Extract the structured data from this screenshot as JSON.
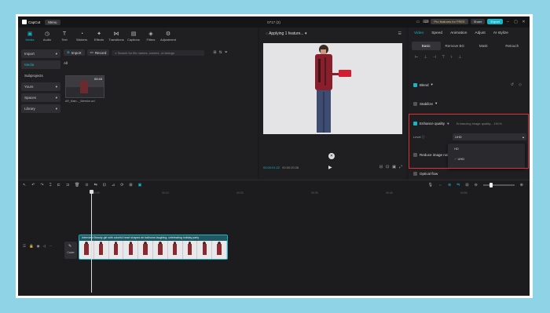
{
  "app": {
    "name": "CapCut",
    "menu_label": "Menu",
    "project_title": "0717 (2)",
    "pro_label": "Pro features for FREE",
    "share_label": "Share",
    "export_label": "Export"
  },
  "tools": [
    {
      "label": "Media",
      "icon": "media-icon"
    },
    {
      "label": "Audio",
      "icon": "audio-icon"
    },
    {
      "label": "Text",
      "icon": "text-icon"
    },
    {
      "label": "Stickers",
      "icon": "stickers-icon"
    },
    {
      "label": "Effects",
      "icon": "effects-icon"
    },
    {
      "label": "Transitions",
      "icon": "transitions-icon"
    },
    {
      "label": "Captions",
      "icon": "captions-icon"
    },
    {
      "label": "Filters",
      "icon": "filters-icon"
    },
    {
      "label": "Adjustment",
      "icon": "adjustment-icon"
    }
  ],
  "sidebar": {
    "import": "Import",
    "media": "Media",
    "subprojects": "Subprojects",
    "yours": "Yours",
    "spaces": "Spaces",
    "library": "Library"
  },
  "media": {
    "import_btn": "Import",
    "record_btn": "Record",
    "search_placeholder": "Search for file names, scenes, or dialogs",
    "all_label": "All",
    "thumb_duration": "00:43",
    "thumb_name": "AR_Main..._Weeshe.avi"
  },
  "player": {
    "status": "Applying 1 feature...",
    "time_current": "00:00:01:22",
    "time_total": "00:00:20:26"
  },
  "props": {
    "tabs": [
      "Video",
      "Speed",
      "Animation",
      "Adjust",
      "AI stylize"
    ],
    "subtabs": [
      "Basic",
      "Remove BG",
      "Mask",
      "Retouch"
    ],
    "blend": "Blend",
    "stabilize": "Stabilize",
    "enhance_quality": "Enhance quality",
    "enhance_status": "Enhancing image quality... 191%",
    "level_label": "Level",
    "level_value": "UHD",
    "reduce_noise": "Reduce image noise",
    "optical_flow": "Optical flow",
    "dropdown_options": [
      "HD",
      "UHD"
    ]
  },
  "timeline": {
    "ruler": [
      "00:00",
      "00:10",
      "00:20",
      "00:30",
      "00:40",
      "00:50"
    ],
    "cover_label": "Cover",
    "clip_title": "Interview Beauty girl with colorful heart shaped air balloons laughing, celebrating holiday party"
  },
  "colors": {
    "accent": "#16b5c8",
    "highlight_box": "#e0313a"
  }
}
